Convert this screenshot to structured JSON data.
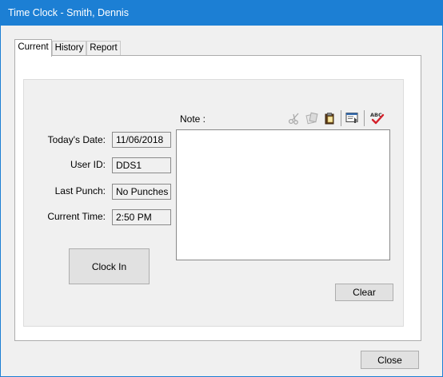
{
  "window": {
    "title": "Time Clock - Smith, Dennis"
  },
  "tabs": [
    {
      "label": "Current"
    },
    {
      "label": "History"
    },
    {
      "label": "Report"
    }
  ],
  "fields": {
    "todays_date": {
      "label": "Today's Date:",
      "value": "11/06/2018"
    },
    "user_id": {
      "label": "User ID:",
      "value": "DDS1"
    },
    "last_punch": {
      "label": "Last Punch:",
      "value": "No Punches"
    },
    "current_time": {
      "label": "Current Time:",
      "value": "2:50 PM"
    }
  },
  "note": {
    "label": "Note :",
    "value": ""
  },
  "toolbar": {
    "icons": [
      "scissors-icon",
      "copy-icon",
      "paste-icon",
      "insert-template-icon",
      "spell-check-icon"
    ],
    "spellcheck_text": "ABC"
  },
  "buttons": {
    "clock_in": "Clock In",
    "clear": "Clear",
    "close": "Close"
  },
  "colors": {
    "titlebar": "#1c7fd4",
    "accent_check": "#d4202a"
  }
}
